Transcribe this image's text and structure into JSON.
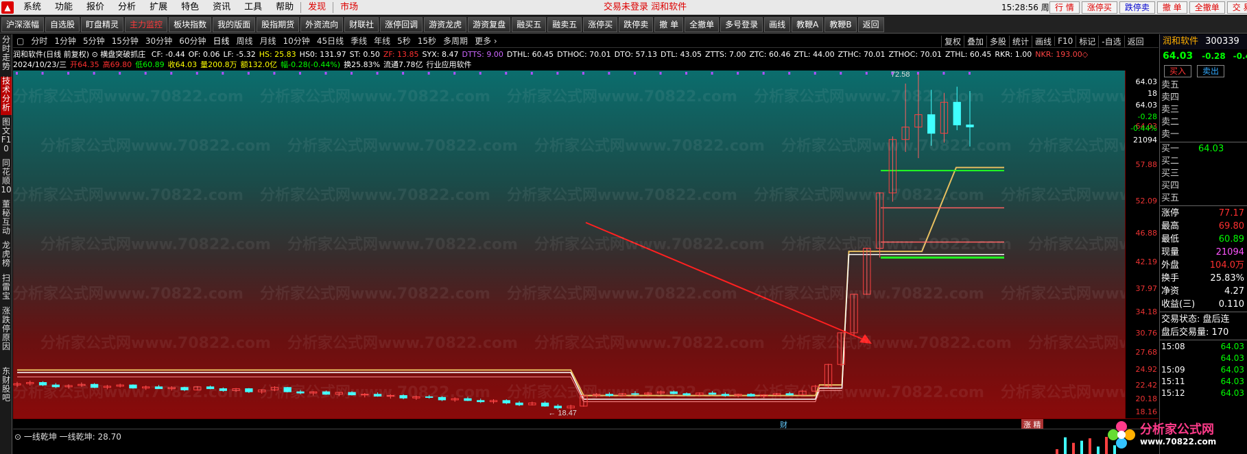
{
  "menubar": {
    "items": [
      "系统",
      "功能",
      "报价",
      "分析",
      "扩展",
      "特色",
      "资讯",
      "工具",
      "帮助"
    ],
    "discover": "发现",
    "market": "市场",
    "status": "交易未登录   润和软件",
    "clock": "15:28:56 周三",
    "trade_buttons": [
      "行 情",
      "涨停买",
      "跌停卖",
      "撤 单",
      "全撤单",
      "交 易"
    ]
  },
  "toolbar": {
    "buttons": [
      "沪深涨幅",
      "自选股",
      "盯盘精灵",
      "主力监控",
      "板块指数",
      "我的版面",
      "股指期货",
      "外资流向",
      "财联社",
      "涨停回调",
      "游资龙虎",
      "游资复盘",
      "融买五",
      "融卖五",
      "涨停买",
      "跌停卖",
      "撤 单",
      "全撤单",
      "多号登录",
      "画线",
      "教鞭A",
      "教鞭B",
      "返回"
    ]
  },
  "left_tabs": [
    "分时走势",
    "技术分析",
    "图文F10",
    "同花顺10",
    "董秘互动",
    "龙虎榜",
    "扫雷宝",
    "涨跌停原因",
    "东财股吧"
  ],
  "period_bar": {
    "items": [
      "分时",
      "1分钟",
      "5分钟",
      "15分钟",
      "30分钟",
      "60分钟",
      "日线",
      "周线",
      "月线",
      "10分钟",
      "45日线",
      "季线",
      "年线",
      "5秒",
      "15秒",
      "多周期",
      "更多 ›"
    ],
    "tools": [
      "复权",
      "叠加",
      "多股",
      "统计",
      "画线",
      "F10",
      "标记",
      "-自选",
      "返回"
    ]
  },
  "info": {
    "line1_label": "润和软件(日线 前复权) ⊙ 横盘突破抓庄",
    "line1": [
      {
        "t": "CF: -0.44",
        "c": "#ffffff"
      },
      {
        "t": "OF: 0.06",
        "c": "#ffffff"
      },
      {
        "t": "LF: -5.32",
        "c": "#ffffff"
      },
      {
        "t": "HS: 25.83",
        "c": "#ffff00"
      },
      {
        "t": "HS0: 131.97",
        "c": "#ffffff"
      },
      {
        "t": "ST: 0.50",
        "c": "#ffffff"
      },
      {
        "t": "ZF: 13.85",
        "c": "#ff3030"
      },
      {
        "t": "SYX: 8.47",
        "c": "#ffffff"
      },
      {
        "t": "DTTS: 9.00",
        "c": "#cc66ff"
      },
      {
        "t": "DTHL: 60.45",
        "c": "#ffffff"
      },
      {
        "t": "DTHOC: 70.01",
        "c": "#ffffff"
      },
      {
        "t": "DTO: 57.13",
        "c": "#ffffff"
      },
      {
        "t": "DTL: 43.05",
        "c": "#ffffff"
      },
      {
        "t": "ZTTS: 7.00",
        "c": "#ffffff"
      },
      {
        "t": "ZTC: 60.46",
        "c": "#ffffff"
      },
      {
        "t": "ZTL: 44.00",
        "c": "#ffffff"
      },
      {
        "t": "ZTHC: 70.01",
        "c": "#ffffff"
      },
      {
        "t": "ZTHOC: 70.01",
        "c": "#ffffff"
      },
      {
        "t": "ZTHL: 60.45",
        "c": "#ffffff"
      },
      {
        "t": "RKR: 1.00",
        "c": "#ffffff"
      },
      {
        "t": "NKR: 193.00◇",
        "c": "#ff4444"
      }
    ],
    "line2": [
      {
        "t": "2024/10/23/三",
        "c": "#ffffff"
      },
      {
        "t": "开64.35",
        "c": "#ff3030"
      },
      {
        "t": "高69.80",
        "c": "#ff3030"
      },
      {
        "t": "低60.89",
        "c": "#00ff00"
      },
      {
        "t": "收64.03",
        "c": "#ffff00"
      },
      {
        "t": "量200.8万",
        "c": "#ffff00"
      },
      {
        "t": "额132.0亿",
        "c": "#ffff00"
      },
      {
        "t": "幅-0.28(-0.44%)",
        "c": "#00ff00"
      },
      {
        "t": "换25.83%",
        "c": "#ffffff"
      },
      {
        "t": "流通7.78亿",
        "c": "#ffffff"
      },
      {
        "t": "行业应用软件",
        "c": "#ffffff"
      }
    ]
  },
  "chart_data": {
    "type": "candlestick",
    "ylim": [
      18.0,
      72.0
    ],
    "yticks": [
      "64.03",
      "18",
      "64.03",
      "-0.28",
      "-0.44%",
      "21094",
      "57.88",
      "52.09",
      "46.88",
      "42.19",
      "37.97",
      "34.18",
      "30.76",
      "27.68",
      "24.92",
      "22.42",
      "20.18",
      "18.16"
    ],
    "ylabels": [
      64.03,
      57.88,
      52.09,
      46.88,
      42.19,
      37.97,
      34.18,
      30.76,
      27.68,
      24.92,
      22.42,
      20.18,
      18.16
    ],
    "annotations": {
      "high_label": "72.58",
      "low_label": "← 18.47"
    },
    "bottom_tags": [
      "财",
      "涨 精"
    ],
    "candles": [
      [
        22.5,
        23.0,
        22.2,
        22.7
      ],
      [
        22.7,
        23.2,
        22.4,
        22.9
      ],
      [
        22.9,
        23.1,
        22.3,
        22.5
      ],
      [
        22.5,
        22.8,
        22.0,
        22.2
      ],
      [
        22.2,
        22.6,
        21.9,
        22.4
      ],
      [
        22.4,
        22.9,
        22.2,
        22.6
      ],
      [
        22.6,
        22.8,
        22.0,
        22.1
      ],
      [
        22.1,
        22.5,
        21.8,
        22.3
      ],
      [
        22.3,
        22.7,
        22.1,
        22.5
      ],
      [
        22.5,
        22.6,
        21.9,
        22.0
      ],
      [
        22.0,
        22.4,
        21.7,
        22.2
      ],
      [
        22.2,
        22.5,
        21.9,
        21.9
      ],
      [
        21.9,
        22.3,
        21.6,
        22.1
      ],
      [
        22.1,
        22.2,
        21.5,
        21.7
      ],
      [
        21.7,
        22.3,
        21.6,
        22.2
      ],
      [
        22.2,
        22.4,
        21.8,
        21.9
      ],
      [
        21.9,
        22.1,
        21.4,
        21.6
      ],
      [
        21.6,
        22.0,
        21.4,
        21.9
      ],
      [
        21.9,
        22.0,
        21.2,
        21.4
      ],
      [
        21.4,
        21.8,
        21.1,
        21.7
      ],
      [
        21.7,
        22.3,
        21.5,
        22.1
      ],
      [
        22.1,
        22.2,
        21.3,
        21.4
      ],
      [
        21.4,
        21.7,
        21.0,
        21.2
      ],
      [
        21.2,
        21.5,
        20.8,
        21.4
      ],
      [
        21.4,
        21.6,
        20.9,
        21.0
      ],
      [
        21.0,
        21.4,
        20.7,
        21.3
      ],
      [
        21.3,
        21.5,
        20.8,
        20.9
      ],
      [
        20.9,
        21.2,
        20.5,
        21.0
      ],
      [
        21.0,
        21.3,
        20.6,
        20.7
      ],
      [
        20.7,
        21.0,
        20.3,
        20.8
      ],
      [
        20.8,
        21.0,
        20.2,
        20.4
      ],
      [
        20.4,
        20.8,
        20.1,
        20.6
      ],
      [
        20.6,
        20.9,
        20.3,
        20.5
      ],
      [
        20.5,
        20.7,
        19.9,
        20.1
      ],
      [
        20.1,
        20.5,
        19.8,
        20.3
      ],
      [
        20.3,
        20.6,
        19.9,
        20.0
      ],
      [
        20.0,
        20.3,
        19.6,
        19.8
      ],
      [
        19.8,
        20.2,
        19.5,
        20.0
      ],
      [
        20.0,
        20.2,
        19.4,
        19.6
      ],
      [
        19.6,
        19.9,
        19.1,
        19.3
      ],
      [
        19.3,
        19.8,
        19.2,
        19.6
      ],
      [
        19.6,
        19.9,
        19.0,
        19.1
      ],
      [
        19.1,
        19.4,
        18.5,
        18.8
      ],
      [
        18.8,
        19.3,
        18.5,
        19.1
      ],
      [
        19.1,
        20.9,
        19.0,
        20.8
      ],
      [
        20.8,
        21.2,
        20.5,
        21.0
      ],
      [
        21.0,
        21.3,
        20.6,
        20.8
      ],
      [
        20.8,
        21.2,
        20.7,
        21.1
      ],
      [
        21.1,
        21.5,
        20.8,
        21.0
      ],
      [
        21.0,
        21.4,
        20.7,
        21.2
      ],
      [
        21.2,
        21.6,
        20.9,
        21.4
      ],
      [
        21.4,
        21.6,
        21.0,
        21.1
      ],
      [
        21.1,
        21.3,
        20.7,
        20.9
      ],
      [
        20.9,
        21.3,
        20.7,
        21.2
      ],
      [
        21.2,
        21.5,
        20.9,
        21.0
      ],
      [
        21.0,
        21.3,
        20.6,
        20.8
      ],
      [
        20.8,
        21.1,
        20.5,
        21.0
      ],
      [
        21.0,
        21.2,
        20.6,
        20.7
      ],
      [
        20.7,
        21.0,
        20.4,
        20.9
      ],
      [
        20.9,
        21.2,
        20.7,
        21.1
      ],
      [
        21.1,
        21.4,
        20.8,
        20.9
      ],
      [
        20.9,
        21.7,
        20.8,
        21.5
      ],
      [
        21.5,
        22.5,
        21.3,
        22.3
      ],
      [
        22.3,
        25.9,
        22.0,
        25.8
      ],
      [
        25.8,
        31.0,
        25.5,
        30.9
      ],
      [
        30.9,
        37.2,
        30.5,
        37.1
      ],
      [
        37.1,
        44.6,
        37.0,
        44.5
      ],
      [
        44.5,
        53.5,
        43.0,
        53.4
      ],
      [
        53.4,
        62.5,
        52.0,
        62.0
      ],
      [
        62.0,
        71.0,
        60.0,
        64.0
      ],
      [
        64.0,
        72.58,
        59.0,
        66.0
      ],
      [
        66.0,
        70.0,
        61.0,
        63.0
      ],
      [
        63.0,
        69.5,
        61.5,
        68.0
      ],
      [
        68.0,
        70.5,
        63.5,
        64.35
      ],
      [
        64.35,
        69.8,
        60.89,
        64.03
      ]
    ]
  },
  "indicator": {
    "label": "⊙ 一线乾坤  一线乾坤: 28.70"
  },
  "right_panel": {
    "name": "润和软件",
    "code": "300339",
    "price": "64.03",
    "change": "-0.28",
    "pct": "-0.4",
    "buy": "买入",
    "sell": "卖出",
    "asks": [
      "卖五",
      "卖四",
      "卖三",
      "卖二",
      "卖一"
    ],
    "bids": [
      {
        "l": "买一",
        "v": "64.03"
      },
      {
        "l": "买二",
        "v": ""
      },
      {
        "l": "买三",
        "v": ""
      },
      {
        "l": "买四",
        "v": ""
      },
      {
        "l": "买五",
        "v": ""
      }
    ],
    "stats": [
      {
        "l": "涨停",
        "v": "77.17",
        "c": "#ff3030"
      },
      {
        "l": "最高",
        "v": "69.80",
        "c": "#ff3030"
      },
      {
        "l": "最低",
        "v": "60.89",
        "c": "#00ff00"
      },
      {
        "l": "现量",
        "v": "21094",
        "c": "#ff55ff"
      },
      {
        "l": "外盘",
        "v": "104.0万",
        "c": "#ff3030"
      },
      {
        "l": "换手",
        "v": "25.83%",
        "c": "#ffffff"
      },
      {
        "l": "净资",
        "v": "4.27",
        "c": "#ffffff"
      },
      {
        "l": "收益(三)",
        "v": "0.110",
        "c": "#ffffff"
      }
    ],
    "trade_status": "交易状态: 盘后连",
    "after_volume": "盘后交易量: 170",
    "ticks": [
      {
        "t": "15:08",
        "p": "64.03"
      },
      {
        "t": "",
        "p": "64.03"
      },
      {
        "t": "15:09",
        "p": "64.03"
      },
      {
        "t": "15:11",
        "p": "64.03"
      },
      {
        "t": "15:12",
        "p": "64.03"
      }
    ]
  },
  "watermark": {
    "text": "分析家公式网www.70822.com"
  },
  "footer_logo": {
    "title": "分析家公式网",
    "url": "www.70822.com"
  }
}
